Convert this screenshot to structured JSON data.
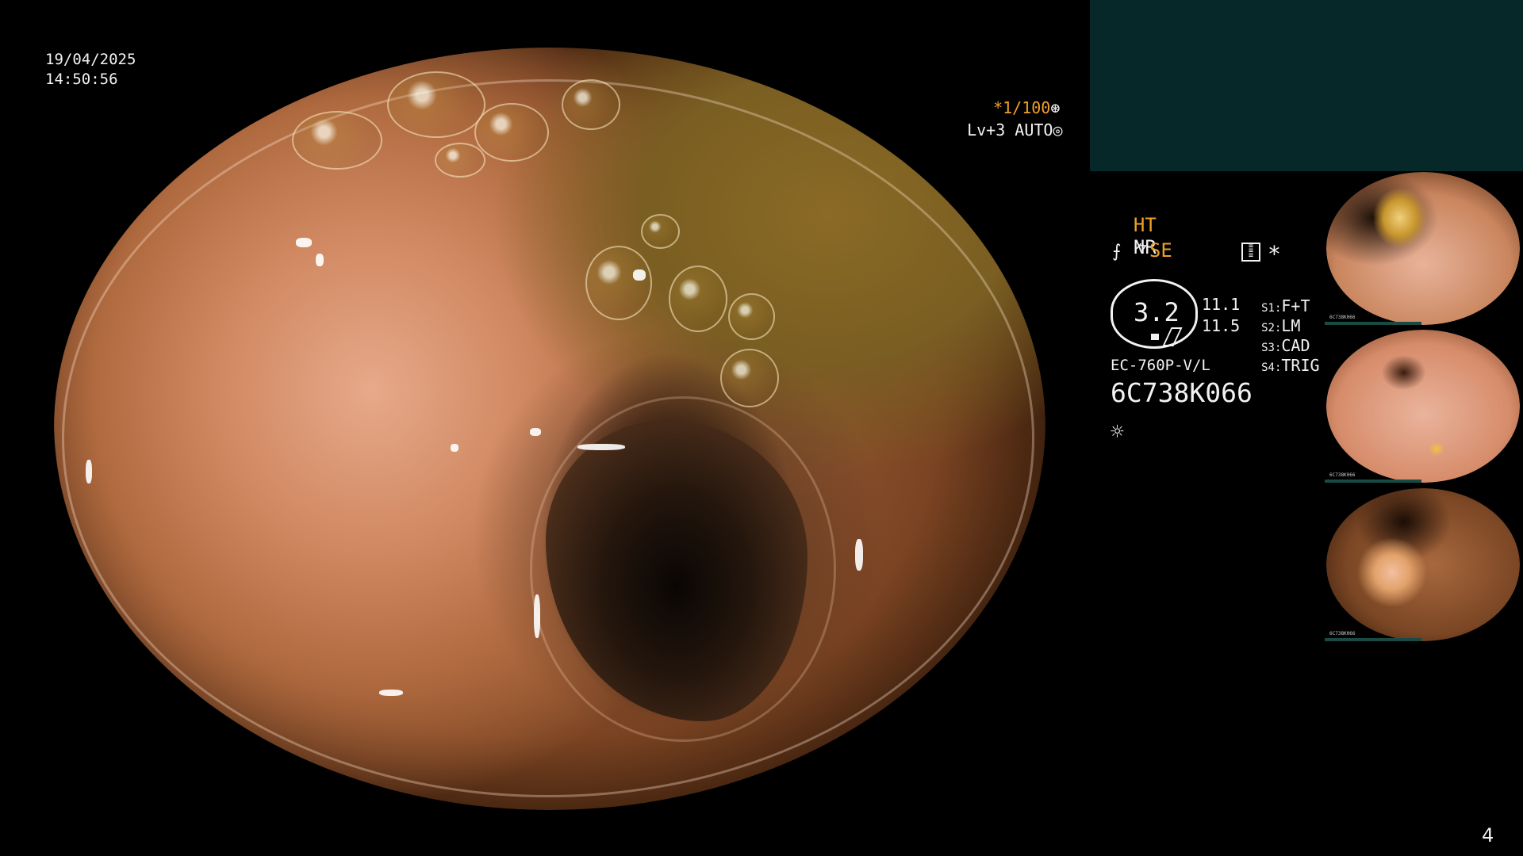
{
  "overlay": {
    "date": "19/04/2025",
    "time": "14:50:56",
    "shutter": "*1/100",
    "shutter_icon": "aperture-icon",
    "iris": "Lv+3 AUTO",
    "iris_icon": "iris-icon"
  },
  "settings": {
    "ht": "HT",
    "nr": "NR",
    "se": "SE",
    "zoom": "3.2",
    "val1": "11.1",
    "val2": "11.5",
    "s1_key": "S1:",
    "s1_val": "F+T",
    "s2_key": "S2:",
    "s2_val": "LM",
    "s3_key": "S3:",
    "s3_val": "CAD",
    "s4_key": "S4:",
    "s4_val": "TRIG",
    "scope_model": "EC-760P-V/L",
    "serial": "6C738K066",
    "record_star": "*"
  },
  "thumbnails": [
    {
      "small_text": "6C738K066"
    },
    {
      "small_text": "6C738K066"
    },
    {
      "small_text": "6C738K066"
    }
  ],
  "page_number": "4",
  "colors": {
    "accent_orange": "#f0a028",
    "panel_teal": "#062829",
    "background": "#000000"
  }
}
